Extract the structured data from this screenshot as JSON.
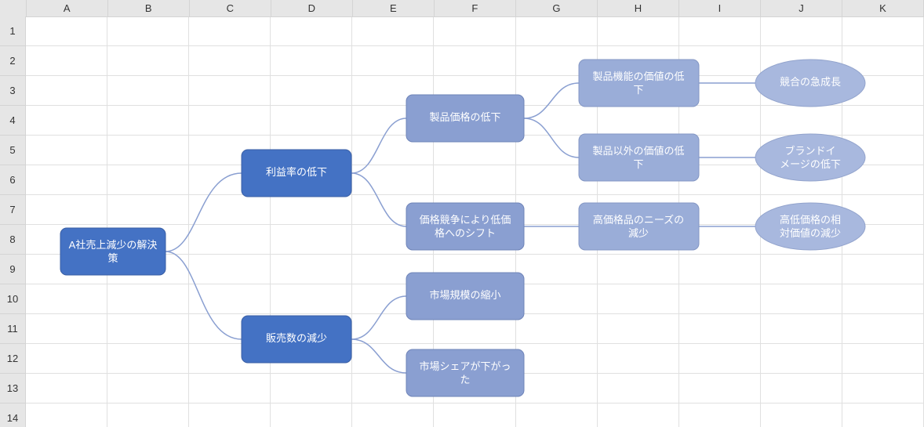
{
  "columns": [
    "A",
    "B",
    "C",
    "D",
    "E",
    "F",
    "G",
    "H",
    "I",
    "J",
    "K"
  ],
  "rows": [
    "1",
    "2",
    "3",
    "4",
    "5",
    "6",
    "7",
    "8",
    "9",
    "10",
    "11",
    "12",
    "13",
    "14"
  ],
  "diagram": {
    "root": {
      "line1": "A社売上減少の解決",
      "line2": "策"
    },
    "l2a": "利益率の低下",
    "l2b": "販売数の減少",
    "l3a": "製品価格の低下",
    "l3b": {
      "line1": "価格競争により低価",
      "line2": "格へのシフト"
    },
    "l3c": "市場規模の縮小",
    "l3d": {
      "line1": "市場シェアが下がっ",
      "line2": "た"
    },
    "l4a": {
      "line1": "製品機能の価値の低",
      "line2": "下"
    },
    "l4b": {
      "line1": "製品以外の価値の低",
      "line2": "下"
    },
    "l4c": {
      "line1": "高価格品のニーズの",
      "line2": "減少"
    },
    "l5a": "競合の急成長",
    "l5b": {
      "line1": "ブランドイ",
      "line2": "メージの低下"
    },
    "l5c": {
      "line1": "高低価格の相",
      "line2": "対価値の減少"
    }
  }
}
